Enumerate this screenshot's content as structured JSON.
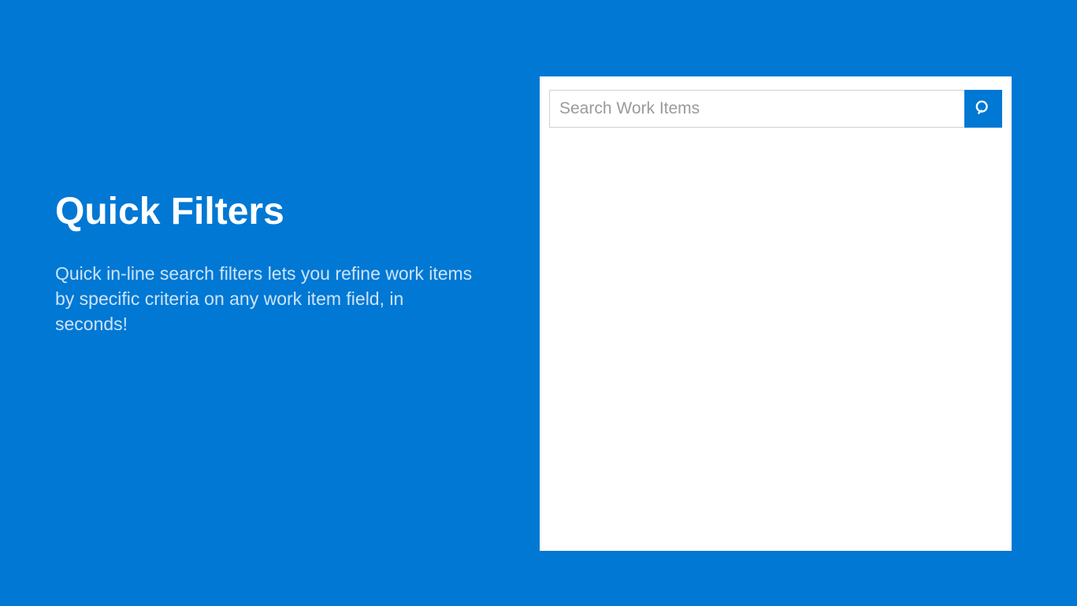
{
  "left": {
    "heading": "Quick Filters",
    "description": "Quick in-line search filters lets you refine work items by specific criteria on any work item field, in seconds!"
  },
  "panel": {
    "search": {
      "placeholder": "Search Work Items",
      "value": ""
    }
  }
}
